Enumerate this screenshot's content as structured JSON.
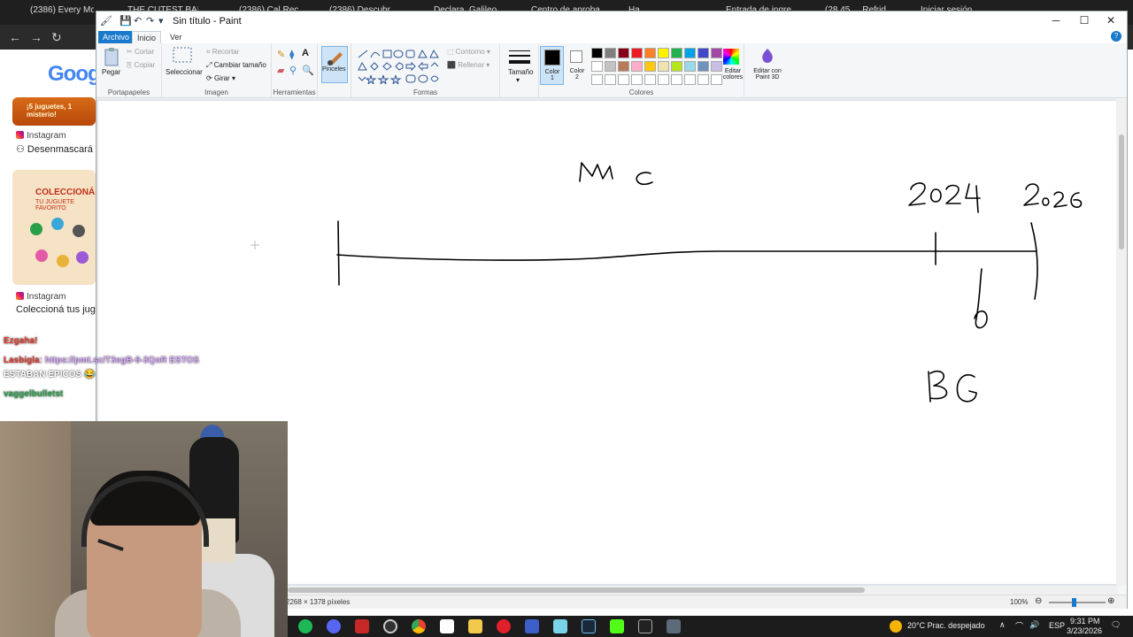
{
  "browser": {
    "tabs": [
      "(2386) Every Mc",
      "THE CUTEST BAI",
      "(2386) Cal Rec",
      "(2386) Descubr",
      "Declara",
      "Galileo",
      "Centro de aproba",
      "Ha",
      "Entrada de ingre",
      "(28 45 ... Refrid",
      "Iniciar sesión"
    ],
    "logo": "Goog",
    "feed": {
      "thumb1_text": "¡5 juguetes, 1 misterio!",
      "ig1": "Instagram",
      "post1": "Desenmascará",
      "thumb2_title": "COLECCIONÁ",
      "thumb2_subtitle": "TU JUGUETE FAVORITO",
      "ig2": "Instagram",
      "post2": "Coleccioná tus jugu"
    }
  },
  "paint": {
    "title": "Sin título - Paint",
    "tabs": {
      "file": "Archivo",
      "home": "Inicio",
      "view": "Ver"
    },
    "clipboard": {
      "paste": "Pegar",
      "cut": "Cortar",
      "copy": "Copiar",
      "label": "Portapapeles"
    },
    "image": {
      "select": "Seleccionar",
      "crop": "Recortar",
      "resize": "Cambiar tamaño",
      "rotate": "Girar",
      "label": "Imagen"
    },
    "tools": {
      "label": "Herramientas"
    },
    "brushes": {
      "label": "Pinceles"
    },
    "shapes": {
      "outline": "Contorno",
      "fill": "Rellenar",
      "label": "Formas"
    },
    "size": {
      "label": "Tamaño"
    },
    "colors": {
      "color1": "Color 1",
      "color2": "Color 2",
      "edit": "Editar colores",
      "paint3d": "Editar con Paint 3D",
      "label": "Colores",
      "palette_row1": [
        "#000000",
        "#7f7f7f",
        "#880015",
        "#ed1c24",
        "#ff7f27",
        "#fff200",
        "#22b14c",
        "#00a2e8",
        "#3f48cc",
        "#a349a4"
      ],
      "palette_row2": [
        "#ffffff",
        "#c3c3c3",
        "#b97a57",
        "#ffaec9",
        "#ffc90e",
        "#efe4b0",
        "#b5e61d",
        "#99d9ea",
        "#7092be",
        "#c8bfe7"
      ]
    },
    "status": {
      "dimensions": "2268 × 1378 píxeles",
      "zoom": "100%"
    }
  },
  "chat": [
    {
      "name": "Ezgaha!",
      "text": ""
    },
    {
      "name": "Lasbigla",
      "text": "https://pmt.sc/T3egB-9-3QoR ESTOS"
    },
    {
      "name": "",
      "text": "ESTABAN EPICOS"
    },
    {
      "name": "vaggelbulletst",
      "text": ""
    }
  ],
  "taskbar": {
    "weather": "20°C  Prac. despejado",
    "lang": "ESP",
    "time": "9:31 PM",
    "date": "3/23/2026"
  }
}
